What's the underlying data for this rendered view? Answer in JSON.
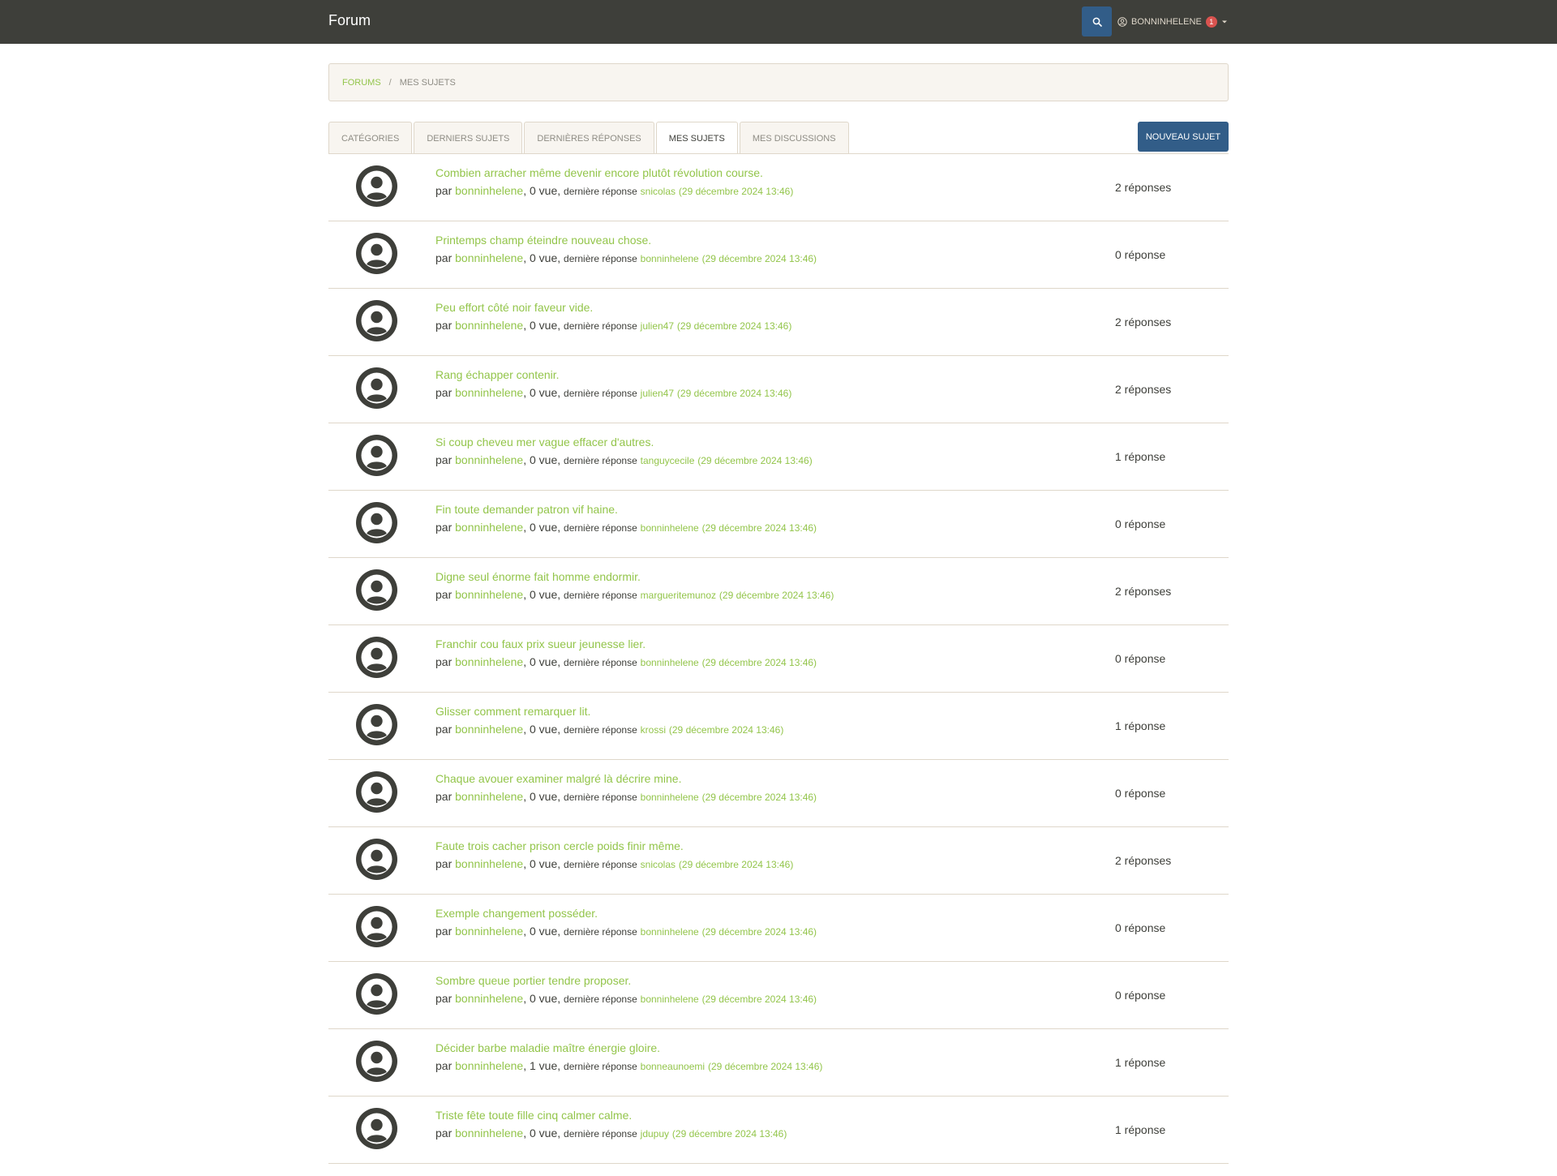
{
  "navbar": {
    "brand": "Forum",
    "username": "BONNINHELENE",
    "notification_count": "1"
  },
  "breadcrumb": {
    "forums": "FORUMS",
    "current": "MES SUJETS",
    "separator": "/"
  },
  "tabs": [
    {
      "label": "CATÉGORIES"
    },
    {
      "label": "DERNIERS SUJETS"
    },
    {
      "label": "DERNIÈRES RÉPONSES"
    },
    {
      "label": "MES SUJETS"
    },
    {
      "label": "MES DISCUSSIONS"
    }
  ],
  "actions": {
    "new_topic": "NOUVEAU SUJET"
  },
  "topics": [
    {
      "title": "Combien arracher même devenir encore plutôt révolution course.",
      "by": "par",
      "author": "bonninhelene",
      "views": "0 vue",
      "last_label": "dernière réponse",
      "last_user": "snicolas",
      "last_date": "(29 décembre 2024 13:46)",
      "replies": "2 réponses"
    },
    {
      "title": "Printemps champ éteindre nouveau chose.",
      "by": "par",
      "author": "bonninhelene",
      "views": "0 vue",
      "last_label": "dernière réponse",
      "last_user": "bonninhelene",
      "last_date": "(29 décembre 2024 13:46)",
      "replies": "0 réponse"
    },
    {
      "title": "Peu effort côté noir faveur vide.",
      "by": "par",
      "author": "bonninhelene",
      "views": "0 vue",
      "last_label": "dernière réponse",
      "last_user": "julien47",
      "last_date": "(29 décembre 2024 13:46)",
      "replies": "2 réponses"
    },
    {
      "title": "Rang échapper contenir.",
      "by": "par",
      "author": "bonninhelene",
      "views": "0 vue",
      "last_label": "dernière réponse",
      "last_user": "julien47",
      "last_date": "(29 décembre 2024 13:46)",
      "replies": "2 réponses"
    },
    {
      "title": "Si coup cheveu mer vague effacer d'autres.",
      "by": "par",
      "author": "bonninhelene",
      "views": "0 vue",
      "last_label": "dernière réponse",
      "last_user": "tanguycecile",
      "last_date": "(29 décembre 2024 13:46)",
      "replies": "1 réponse"
    },
    {
      "title": "Fin toute demander patron vif haine.",
      "by": "par",
      "author": "bonninhelene",
      "views": "0 vue",
      "last_label": "dernière réponse",
      "last_user": "bonninhelene",
      "last_date": "(29 décembre 2024 13:46)",
      "replies": "0 réponse"
    },
    {
      "title": "Digne seul énorme fait homme endormir.",
      "by": "par",
      "author": "bonninhelene",
      "views": "0 vue",
      "last_label": "dernière réponse",
      "last_user": "margueritemunoz",
      "last_date": "(29 décembre 2024 13:46)",
      "replies": "2 réponses"
    },
    {
      "title": "Franchir cou faux prix sueur jeunesse lier.",
      "by": "par",
      "author": "bonninhelene",
      "views": "0 vue",
      "last_label": "dernière réponse",
      "last_user": "bonninhelene",
      "last_date": "(29 décembre 2024 13:46)",
      "replies": "0 réponse"
    },
    {
      "title": "Glisser comment remarquer lit.",
      "by": "par",
      "author": "bonninhelene",
      "views": "0 vue",
      "last_label": "dernière réponse",
      "last_user": "krossi",
      "last_date": "(29 décembre 2024 13:46)",
      "replies": "1 réponse"
    },
    {
      "title": "Chaque avouer examiner malgré là décrire mine.",
      "by": "par",
      "author": "bonninhelene",
      "views": "0 vue",
      "last_label": "dernière réponse",
      "last_user": "bonninhelene",
      "last_date": "(29 décembre 2024 13:46)",
      "replies": "0 réponse"
    },
    {
      "title": "Faute trois cacher prison cercle poids finir même.",
      "by": "par",
      "author": "bonninhelene",
      "views": "0 vue",
      "last_label": "dernière réponse",
      "last_user": "snicolas",
      "last_date": "(29 décembre 2024 13:46)",
      "replies": "2 réponses"
    },
    {
      "title": "Exemple changement posséder.",
      "by": "par",
      "author": "bonninhelene",
      "views": "0 vue",
      "last_label": "dernière réponse",
      "last_user": "bonninhelene",
      "last_date": "(29 décembre 2024 13:46)",
      "replies": "0 réponse"
    },
    {
      "title": "Sombre queue portier tendre proposer.",
      "by": "par",
      "author": "bonninhelene",
      "views": "0 vue",
      "last_label": "dernière réponse",
      "last_user": "bonninhelene",
      "last_date": "(29 décembre 2024 13:46)",
      "replies": "0 réponse"
    },
    {
      "title": "Décider barbe maladie maître énergie gloire.",
      "by": "par",
      "author": "bonninhelene",
      "views": "1 vue",
      "last_label": "dernière réponse",
      "last_user": "bonneaunoemi",
      "last_date": "(29 décembre 2024 13:46)",
      "replies": "1 réponse"
    },
    {
      "title": "Triste fête toute fille cinq calmer calme.",
      "by": "par",
      "author": "bonninhelene",
      "views": "0 vue",
      "last_label": "dernière réponse",
      "last_user": "jdupuy",
      "last_date": "(29 décembre 2024 13:46)",
      "replies": "1 réponse"
    }
  ]
}
